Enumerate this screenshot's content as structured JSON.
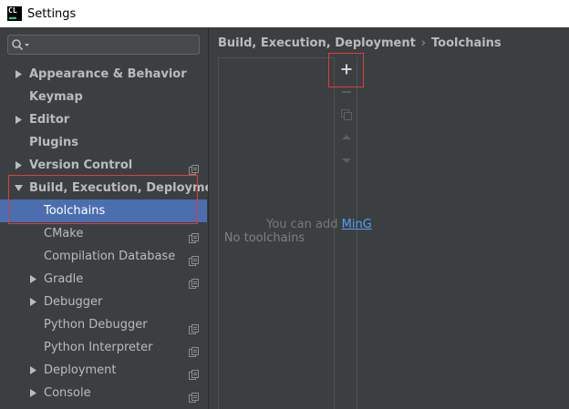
{
  "window": {
    "app_icon_text": "CL",
    "title": "Settings"
  },
  "sidebar": {
    "search": {
      "value": "",
      "placeholder": ""
    },
    "items": [
      {
        "label": "Appearance & Behavior",
        "level": 0,
        "arrow": "collapsed",
        "bold": true,
        "page_icon": false,
        "selected": false
      },
      {
        "label": "Keymap",
        "level": 0,
        "arrow": "none",
        "bold": true,
        "page_icon": false,
        "selected": false
      },
      {
        "label": "Editor",
        "level": 0,
        "arrow": "collapsed",
        "bold": true,
        "page_icon": false,
        "selected": false
      },
      {
        "label": "Plugins",
        "level": 0,
        "arrow": "none",
        "bold": true,
        "page_icon": false,
        "selected": false
      },
      {
        "label": "Version Control",
        "level": 0,
        "arrow": "collapsed",
        "bold": true,
        "page_icon": true,
        "selected": false
      },
      {
        "label": "Build, Execution, Deployment",
        "level": 0,
        "arrow": "expanded",
        "bold": true,
        "page_icon": false,
        "selected": false
      },
      {
        "label": "Toolchains",
        "level": 1,
        "arrow": "none",
        "bold": false,
        "page_icon": false,
        "selected": true
      },
      {
        "label": "CMake",
        "level": 1,
        "arrow": "none",
        "bold": false,
        "page_icon": true,
        "selected": false
      },
      {
        "label": "Compilation Database",
        "level": 1,
        "arrow": "none",
        "bold": false,
        "page_icon": true,
        "selected": false
      },
      {
        "label": "Gradle",
        "level": 1,
        "arrow": "collapsed",
        "bold": false,
        "page_icon": true,
        "selected": false
      },
      {
        "label": "Debugger",
        "level": 1,
        "arrow": "collapsed",
        "bold": false,
        "page_icon": false,
        "selected": false
      },
      {
        "label": "Python Debugger",
        "level": 1,
        "arrow": "none",
        "bold": false,
        "page_icon": true,
        "selected": false
      },
      {
        "label": "Python Interpreter",
        "level": 1,
        "arrow": "none",
        "bold": false,
        "page_icon": true,
        "selected": false
      },
      {
        "label": "Deployment",
        "level": 1,
        "arrow": "collapsed",
        "bold": false,
        "page_icon": true,
        "selected": false
      },
      {
        "label": "Console",
        "level": 1,
        "arrow": "collapsed",
        "bold": false,
        "page_icon": true,
        "selected": false
      }
    ]
  },
  "content": {
    "breadcrumb": {
      "parent": "Build, Execution, Deployment",
      "separator": "›",
      "current": "Toolchains"
    },
    "list": {
      "empty_text": "No toolchains"
    },
    "toolbar": [
      {
        "name": "add-button",
        "icon": "plus-icon",
        "enabled": true,
        "highlighted": true
      },
      {
        "name": "remove-button",
        "icon": "minus-icon",
        "enabled": false,
        "highlighted": false
      },
      {
        "name": "copy-button",
        "icon": "copy-icon",
        "enabled": false,
        "highlighted": false
      },
      {
        "name": "move-up-button",
        "icon": "arrow-up-icon",
        "enabled": false,
        "highlighted": false
      },
      {
        "name": "move-down-button",
        "icon": "arrow-down-icon",
        "enabled": false,
        "highlighted": false
      }
    ],
    "hint": {
      "text": "You can add ",
      "link": "MinG"
    }
  },
  "colors": {
    "background": "#3c3f41",
    "selection": "#4b6eaf",
    "text": "#bbbbbb",
    "muted_text": "#808080",
    "link": "#589df6",
    "annotation_red": "#e03c3c"
  }
}
